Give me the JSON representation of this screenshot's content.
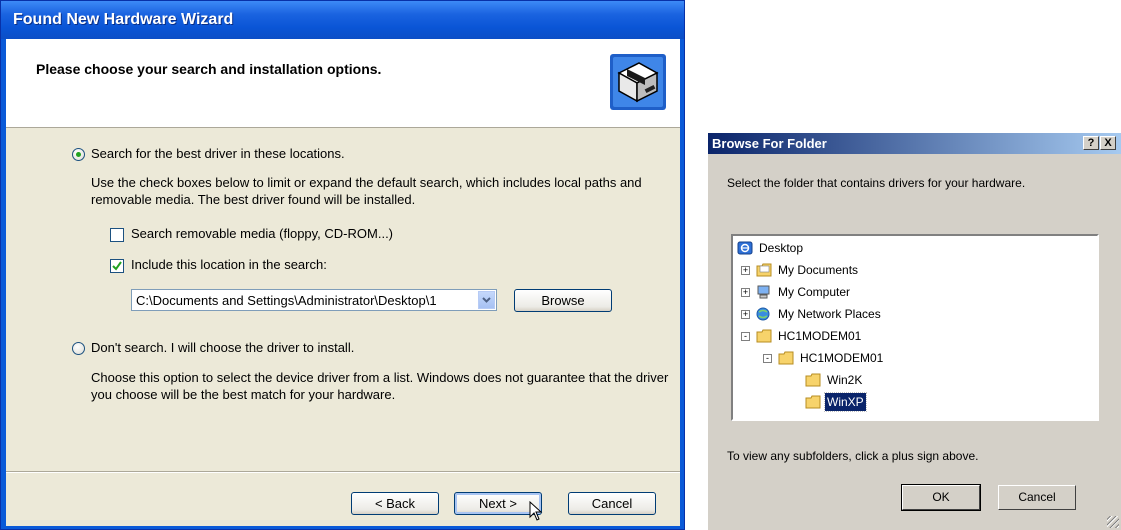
{
  "wizard": {
    "title": "Found New Hardware Wizard",
    "heading": "Please choose your search and installation options.",
    "option_search": {
      "label": "Search for the best driver in these locations.",
      "selected": true,
      "description": "Use the check boxes below to limit or expand the default search, which includes local paths and removable media. The best driver found will be installed.",
      "removable_media": {
        "label": "Search removable media (floppy, CD-ROM...)",
        "checked": false
      },
      "include_location": {
        "label": "Include this location in the search:",
        "checked": true
      },
      "location_value": "C:\\Documents and Settings\\Administrator\\Desktop\\1",
      "browse_label": "Browse"
    },
    "option_manual": {
      "label": "Don't search. I will choose the driver to install.",
      "selected": false,
      "description": "Choose this option to select the device driver from a list.  Windows does not guarantee that the driver you choose will be the best match for your hardware."
    },
    "buttons": {
      "back": "< Back",
      "next": "Next >",
      "cancel": "Cancel"
    }
  },
  "browse_dialog": {
    "title": "Browse For Folder",
    "help_button": "?",
    "close_button": "X",
    "instruction": "Select the folder that contains drivers for your hardware.",
    "tree": [
      {
        "label": "Desktop",
        "icon": "desktop-icon"
      },
      {
        "label": "My Documents",
        "icon": "documents-folder-icon",
        "expander": "+"
      },
      {
        "label": "My Computer",
        "icon": "computer-icon",
        "expander": "+"
      },
      {
        "label": "My Network Places",
        "icon": "network-places-icon",
        "expander": "+"
      },
      {
        "label": "HC1MODEM01",
        "icon": "folder-icon",
        "expander": "-"
      },
      {
        "label": "HC1MODEM01",
        "icon": "folder-icon",
        "expander": "-"
      },
      {
        "label": "Win2K",
        "icon": "folder-icon"
      },
      {
        "label": "WinXP",
        "icon": "folder-icon",
        "selected": true
      }
    ],
    "hint": "To view any subfolders, click a plus sign above.",
    "buttons": {
      "ok": "OK",
      "cancel": "Cancel"
    }
  },
  "colors": {
    "xp_title_blue": "#0a55d6",
    "classic_title": "#0a246a",
    "dialog_face": "#ece9d8",
    "selection": "#0a246a"
  }
}
